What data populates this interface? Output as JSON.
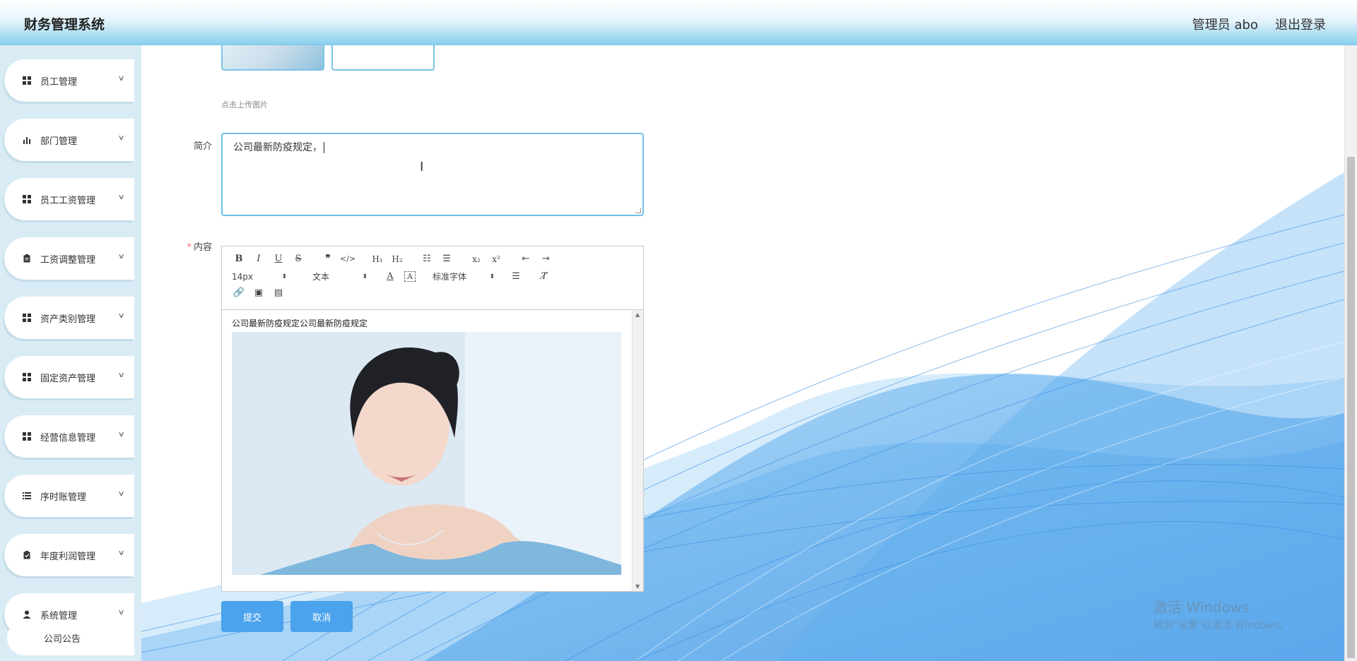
{
  "header": {
    "app_title": "财务管理系统",
    "user_label": "管理员 abo",
    "logout_label": "退出登录"
  },
  "sidebar": {
    "items": [
      {
        "label": "员工管理",
        "icon": "grid-icon"
      },
      {
        "label": "部门管理",
        "icon": "bar-chart-icon"
      },
      {
        "label": "员工工资管理",
        "icon": "grid-icon"
      },
      {
        "label": "工资调整管理",
        "icon": "clipboard-icon"
      },
      {
        "label": "资产类别管理",
        "icon": "grid-icon"
      },
      {
        "label": "固定资产管理",
        "icon": "grid-icon"
      },
      {
        "label": "经营信息管理",
        "icon": "grid-icon"
      },
      {
        "label": "序时账管理",
        "icon": "list-icon"
      },
      {
        "label": "年度利润管理",
        "icon": "clipboard-check-icon"
      },
      {
        "label": "系统管理",
        "icon": "user-icon"
      }
    ],
    "sub_item": "公司公告"
  },
  "form": {
    "upload_hint": "点击上传图片",
    "intro_label": "简介",
    "intro_value": "公司最新防疫规定，",
    "content_label": "内容",
    "content_text": "公司最新防疫规定公司最新防疫规定",
    "font_size_value": "14px",
    "paragraph_value": "文本",
    "font_family_value": "标准字体",
    "submit_label": "提交",
    "cancel_label": "取消"
  },
  "watermark": {
    "line1": "激活 Windows",
    "line2": "转到\"设置\"以激活 Windows。"
  }
}
